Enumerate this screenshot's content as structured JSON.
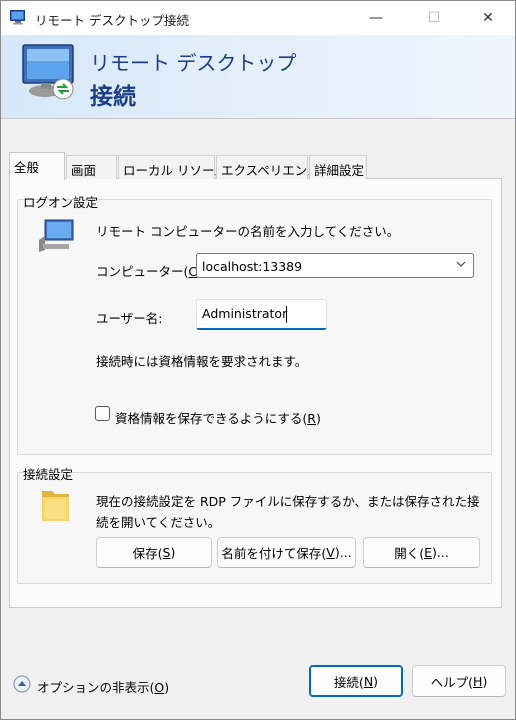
{
  "window": {
    "title": "リモート デスクトップ接続",
    "minimize_glyph": "—",
    "maximize_glyph": "☐",
    "close_glyph": "✕"
  },
  "banner": {
    "line1": "リモート デスクトップ",
    "line2": "接続",
    "icon": "remote-desktop-monitor-icon"
  },
  "tabs": [
    {
      "label": "全般",
      "active": true
    },
    {
      "label": "画面",
      "active": false
    },
    {
      "label": "ローカル リソース",
      "active": false
    },
    {
      "label": "エクスペリエンス",
      "active": false
    },
    {
      "label": "詳細設定",
      "active": false
    }
  ],
  "logon": {
    "group_title": "ログオン設定",
    "instruction": "リモート コンピューターの名前を入力してください。",
    "computer_label_prefix": "コンピューター(",
    "computer_label_key": "C",
    "computer_label_suffix": "):",
    "computer_value": "localhost:13389",
    "user_label": "ユーザー名:",
    "user_value": "Administrator",
    "credential_note": "接続時には資格情報を要求されます。",
    "save_cred_prefix": "資格情報を保存できるようにする(",
    "save_cred_key": "R",
    "save_cred_suffix": ")",
    "save_cred_checked": false
  },
  "connection": {
    "group_title": "接続設定",
    "line1": "現在の接続設定を RDP ファイルに保存するか、または保存された接",
    "line2": "続を開いてください。",
    "save_prefix": "保存(",
    "save_key": "S",
    "save_suffix": ")",
    "saveas_prefix": "名前を付けて保存(",
    "saveas_key": "V",
    "saveas_suffix": ")...",
    "open_prefix": "開く(",
    "open_key": "E",
    "open_suffix": ")..."
  },
  "footer": {
    "options_prefix": "オプションの非表示(",
    "options_key": "O",
    "options_suffix": ")",
    "connect_prefix": "接続(",
    "connect_key": "N",
    "connect_suffix": ")",
    "help_prefix": "ヘルプ(",
    "help_key": "H",
    "help_suffix": ")"
  },
  "colors": {
    "banner_text": "#1b3e8a",
    "accent": "#0067c0"
  }
}
